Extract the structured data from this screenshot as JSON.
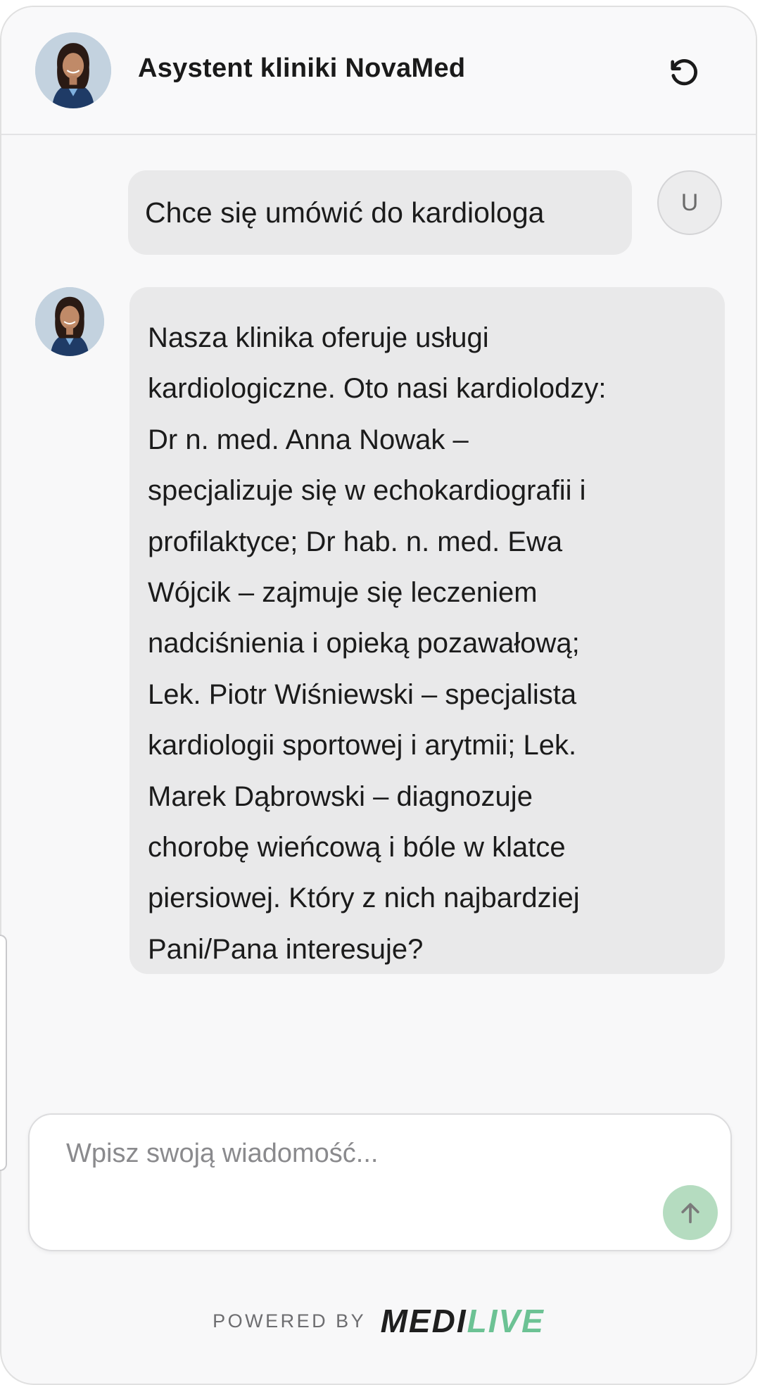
{
  "header": {
    "title": "Asystent kliniki NovaMed",
    "avatar_icon": "assistant-avatar",
    "refresh_icon": "refresh-icon"
  },
  "messages": {
    "user": {
      "text": "Chce się umówić do kardiologa",
      "avatar_initial": "U"
    },
    "bot": {
      "lines": [
        "Nasza klinika oferuje usługi",
        "kardiologiczne. Oto nasi kardiolodzy:",
        "Dr n. med. Anna Nowak –",
        "specjalizuje się w echokardiografii i",
        "profilaktyce; Dr hab. n. med. Ewa",
        "Wójcik – zajmuje się leczeniem",
        "nadciśnienia i opieką pozawałową;",
        "Lek. Piotr Wiśniewski – specjalista",
        "kardiologii sportowej i arytmii; Lek.",
        "Marek Dąbrowski – diagnozuje",
        "chorobę wieńcową i bóle w klatce",
        "piersiowej. Który z nich najbardziej",
        "Pani/Pana interesuje?"
      ]
    }
  },
  "composer": {
    "placeholder": "Wpisz swoją wiadomość...",
    "value": "",
    "send_icon": "arrow-up-icon",
    "send_color": "#b5dcc0"
  },
  "footer": {
    "powered_by": "POWERED BY",
    "brand_part1": "MEDI",
    "brand_part2": "LIVE",
    "brand_accent": "#6cc294"
  }
}
